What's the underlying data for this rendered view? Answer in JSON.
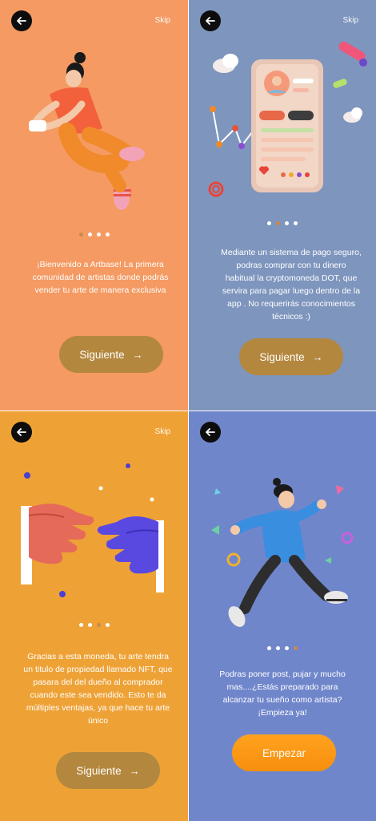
{
  "screens": [
    {
      "skip": "Skip",
      "description": "¡Bienvenido a Artbase! La primera comunidad de artistas donde podrás vender tu arte de manera exclusiva",
      "button": "Siguiente",
      "button_arrow": "→",
      "active_dot": 1
    },
    {
      "skip": "Skip",
      "description": "Mediante un sistema de pago seguro, podras comprar con tu dinero habitual la cryptomoneda DOT, que servira para pagar luego dentro de la app . No requerirás conocimientos técnicos :)",
      "button": "Siguiente",
      "button_arrow": "→",
      "active_dot": 2
    },
    {
      "skip": "Skip",
      "description": "Gracias a esta moneda, tu arte tendra un titulo de propiedad llamado NFT, que pasara del del dueño al comprador cuando este sea vendido. Esto te da múltiples ventajas, ya que hace tu arte único",
      "button": "Siguiente",
      "button_arrow": "→",
      "active_dot": 3
    },
    {
      "description": "Podras poner post, pujar y mucho mas....¿Estás preparado para alcanzar tu sueño como artista? ¡Empieza ya!",
      "button": "Empezar",
      "active_dot": 4
    }
  ],
  "colors": {
    "screen1_bg": "#F49A62",
    "screen2_bg": "#7E95BE",
    "screen3_bg": "#EEA236",
    "screen4_bg": "#7086CB",
    "button_brown": "#B4873E",
    "button_orange": "#FFA21E"
  },
  "icons": {
    "back": "arrow-left-icon",
    "next": "arrow-right-icon"
  }
}
